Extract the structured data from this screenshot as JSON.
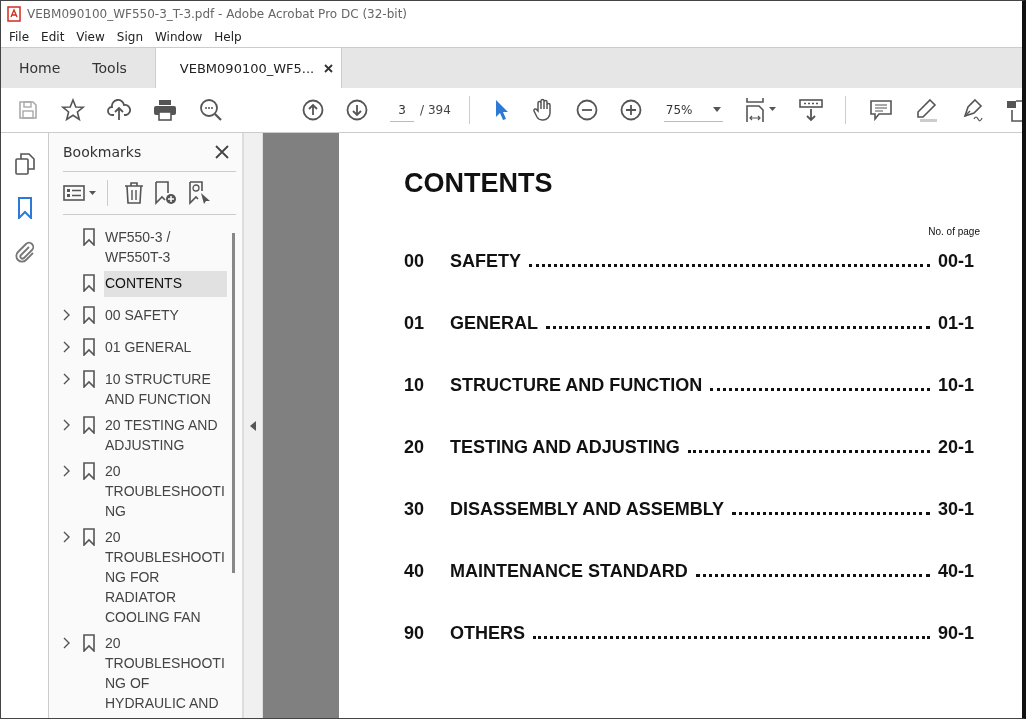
{
  "window": {
    "title": "VEBM090100_WF550-3_T-3.pdf - Adobe Acrobat Pro DC (32-bit)"
  },
  "menu": [
    "File",
    "Edit",
    "View",
    "Sign",
    "Window",
    "Help"
  ],
  "tabs": [
    {
      "label": "Home",
      "selected": false,
      "closable": false
    },
    {
      "label": "Tools",
      "selected": false,
      "closable": false
    },
    {
      "label": "VEBM090100_WF5...",
      "selected": true,
      "closable": true
    }
  ],
  "toolbar": {
    "page": "3",
    "page_total": "/ 394",
    "zoom": "75%"
  },
  "side_rail": [
    {
      "kind": "pages",
      "selected": false
    },
    {
      "kind": "bookmark",
      "selected": true
    },
    {
      "kind": "attachment",
      "selected": false
    }
  ],
  "bookmarks": {
    "title": "Bookmarks",
    "items": [
      {
        "label": "WF550-3 / WF550T-3",
        "expandable": false,
        "selected": false
      },
      {
        "label": "CONTENTS",
        "expandable": false,
        "selected": true
      },
      {
        "label": "00 SAFETY",
        "expandable": true,
        "selected": false
      },
      {
        "label": "01 GENERAL",
        "expandable": true,
        "selected": false
      },
      {
        "label": "10 STRUCTURE AND FUNCTION",
        "expandable": true,
        "selected": false
      },
      {
        "label": "20 TESTING AND ADJUSTING",
        "expandable": true,
        "selected": false
      },
      {
        "label": "20 TROUBLESHOOTING",
        "expandable": true,
        "selected": false
      },
      {
        "label": "20 TROUBLESHOOTING FOR RADIATOR COOLING FAN",
        "expandable": true,
        "selected": false
      },
      {
        "label": "20 TROUBLESHOOTING OF HYDRAULIC AND",
        "expandable": true,
        "selected": false
      }
    ]
  },
  "document": {
    "heading": "CONTENTS",
    "page_column": "No. of page",
    "entries": [
      {
        "number": "00",
        "title": "SAFETY",
        "page": "00-1"
      },
      {
        "number": "01",
        "title": "GENERAL",
        "page": "01-1"
      },
      {
        "number": "10",
        "title": "STRUCTURE AND FUNCTION",
        "page": "10-1"
      },
      {
        "number": "20",
        "title": "TESTING AND ADJUSTING",
        "page": "20-1"
      },
      {
        "number": "30",
        "title": "DISASSEMBLY AND ASSEMBLY",
        "page": "30-1"
      },
      {
        "number": "40",
        "title": "MAINTENANCE STANDARD",
        "page": "40-1"
      },
      {
        "number": "90",
        "title": "OTHERS",
        "page": "90-1"
      }
    ]
  }
}
